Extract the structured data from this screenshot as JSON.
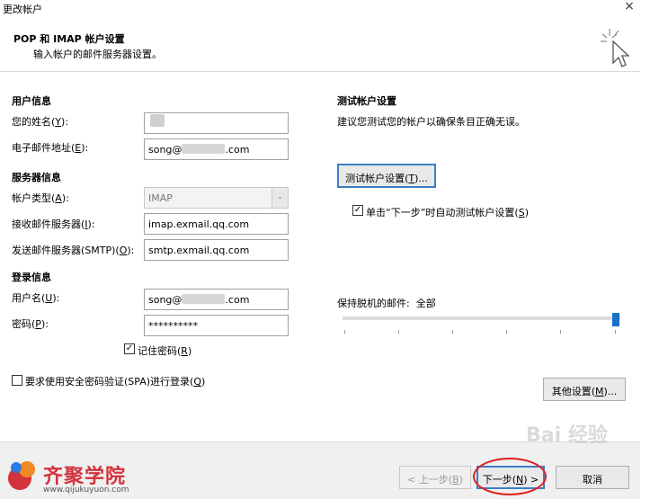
{
  "window": {
    "title": "更改帐户",
    "close_glyph": "×"
  },
  "header": {
    "title": "POP 和 IMAP 帐户设置",
    "subtitle": "输入帐户的邮件服务器设置。"
  },
  "user_info": {
    "section": "用户信息",
    "name_label": "您的姓名(",
    "name_key": "Y",
    "email_label": "电子邮件地址(",
    "email_key": "E",
    "email_prefix": "song@",
    "email_suffix": ".com"
  },
  "server_info": {
    "section": "服务器信息",
    "type_label": "帐户类型(",
    "type_key": "A",
    "type_value": "IMAP",
    "incoming_label": "接收邮件服务器(",
    "incoming_key": "I",
    "incoming_value": "imap.exmail.qq.com",
    "outgoing_label": "发送邮件服务器(SMTP)(",
    "outgoing_key": "O",
    "outgoing_value": "smtp.exmail.qq.com"
  },
  "login_info": {
    "section": "登录信息",
    "username_label": "用户名(",
    "username_key": "U",
    "username_prefix": "song@",
    "username_suffix": ".com",
    "password_label": "密码(",
    "password_key": "P",
    "password_value": "**********",
    "remember_label": "记住密码(",
    "remember_key": "R",
    "remember_checked": true,
    "spa_label": "要求使用安全密码验证(SPA)进行登录(",
    "spa_key": "Q",
    "spa_checked": false
  },
  "test": {
    "section": "测试帐户设置",
    "description": "建议您测试您的帐户以确保条目正确无误。",
    "button_label": "测试帐户设置(",
    "button_key": "T",
    "auto_test_label": "单击“下一步”时自动测试帐户设置(",
    "auto_test_key": "S",
    "auto_test_checked": true
  },
  "offline": {
    "label": "保持脱机的邮件:",
    "value": "全部",
    "level": 1.0
  },
  "more_settings": {
    "label": "其他设置(",
    "key": "M"
  },
  "footer": {
    "back_label": "< 上一步(",
    "back_key": "B",
    "next_label": "下一步(",
    "next_key": "N",
    "cancel_label": "取消",
    "logo_name": "齐聚学院",
    "logo_url": "www.qijukuyuon.com",
    "watermark": "Bai 经验"
  },
  "colors": {
    "accent": "#1a73c8",
    "logo_red": "#d2323c",
    "highlight_ring": "#e02020"
  }
}
